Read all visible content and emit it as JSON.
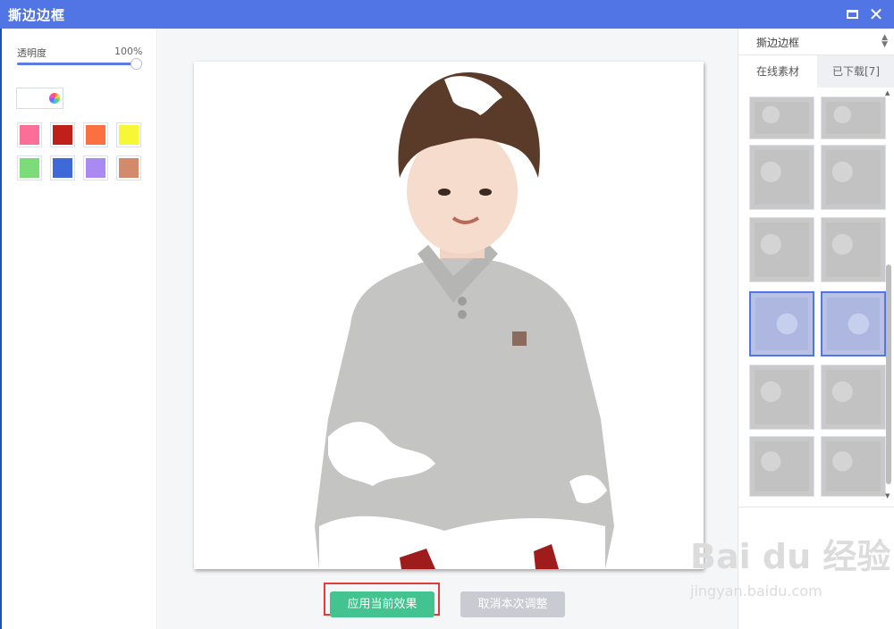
{
  "window": {
    "title": "撕边边框"
  },
  "left_panel": {
    "opacity_label": "透明度",
    "opacity_value": "100%",
    "opacity_level": 1.0,
    "swatches": [
      "#fa6f98",
      "#c0201a",
      "#fa7040",
      "#f7f735",
      "#7ddc7a",
      "#3f69d8",
      "#a98af0",
      "#d38a6a"
    ]
  },
  "canvas": {
    "apply_button": "应用当前效果",
    "cancel_button": "取消本次调整"
  },
  "right_panel": {
    "select_value": "撕边边框",
    "tabs": [
      "在线素材",
      "已下载[7]"
    ]
  },
  "watermark": {
    "logo": "Bai du 经验",
    "url": "jingyan.baidu.com"
  }
}
